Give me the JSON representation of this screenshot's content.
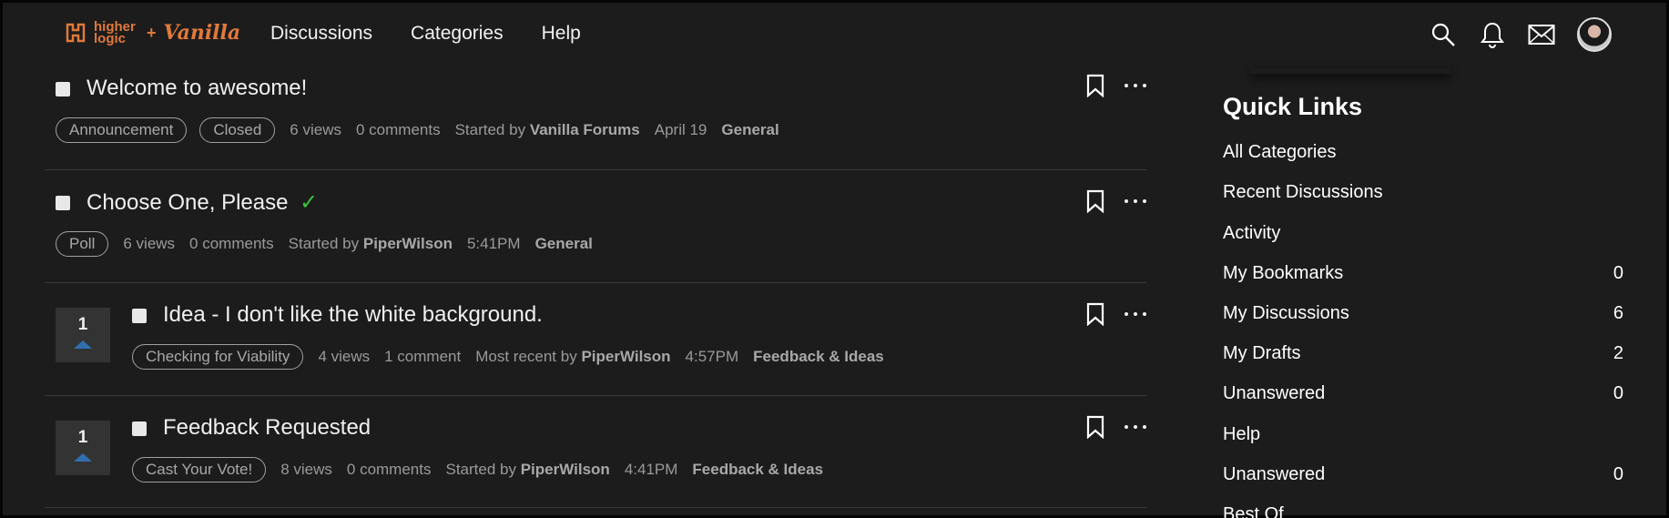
{
  "header": {
    "logo_text": "higher logic",
    "logo_plus": "+",
    "logo_vanilla": "Vanilla",
    "nav": [
      "Discussions",
      "Categories",
      "Help"
    ]
  },
  "discussions": [
    {
      "title": "Welcome to awesome!",
      "tags": [
        "Announcement",
        "Closed"
      ],
      "views": "6 views",
      "comments": "0 comments",
      "started_label": "Started by",
      "author": "Vanilla Forums",
      "date": "April 19",
      "category": "General"
    },
    {
      "title": "Choose One, Please",
      "check": "✓",
      "tags": [
        "Poll"
      ],
      "views": "6 views",
      "comments": "0 comments",
      "started_label": "Started by",
      "author": "PiperWilson",
      "date": "5:41PM",
      "category": "General"
    },
    {
      "votes": "1",
      "title": "Idea - I don't like the white background.",
      "tags": [
        "Checking for Viability"
      ],
      "views": "4 views",
      "comments": "1 comment",
      "started_label": "Most recent by",
      "author": "PiperWilson",
      "date": "4:57PM",
      "category": "Feedback & Ideas"
    },
    {
      "votes": "1",
      "title": "Feedback Requested",
      "tags": [
        "Cast Your Vote!"
      ],
      "views": "8 views",
      "comments": "0 comments",
      "started_label": "Started by",
      "author": "PiperWilson",
      "date": "4:41PM",
      "category": "Feedback & Ideas"
    }
  ],
  "sidebar": {
    "title": "Quick Links",
    "links": [
      {
        "label": "All Categories",
        "count": ""
      },
      {
        "label": "Recent Discussions",
        "count": ""
      },
      {
        "label": "Activity",
        "count": ""
      },
      {
        "label": "My Bookmarks",
        "count": "0"
      },
      {
        "label": "My Discussions",
        "count": "6"
      },
      {
        "label": "My Drafts",
        "count": "2"
      },
      {
        "label": "Unanswered",
        "count": "0"
      },
      {
        "label": "Help",
        "count": ""
      },
      {
        "label": "Unanswered",
        "count": "0"
      },
      {
        "label": "Best Of",
        "count": ""
      }
    ]
  },
  "colors": {
    "background": "#1c1c1c",
    "accent_logo": "#e0793a",
    "check": "#3fbf3f",
    "vote_arrow": "#2f6fae"
  }
}
